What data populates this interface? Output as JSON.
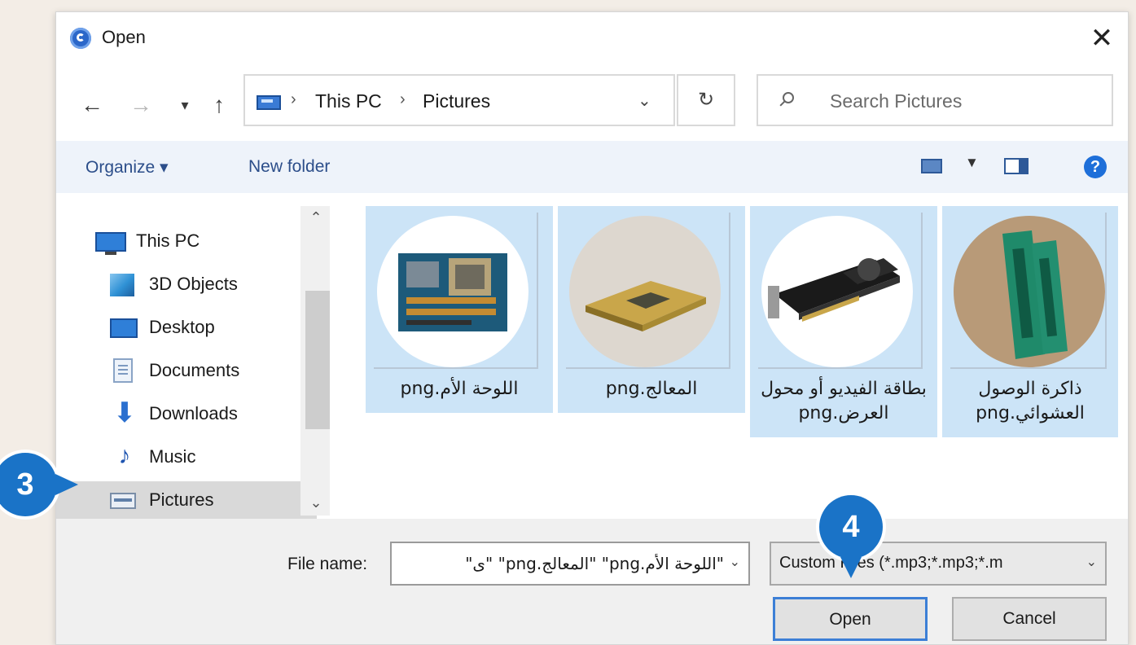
{
  "window": {
    "title": "Open",
    "close_glyph": "✕"
  },
  "nav": {
    "back_glyph": "←",
    "forward_glyph": "→",
    "recent_glyph": "▾",
    "up_glyph": "↑",
    "breadcrumb": [
      "This PC",
      "Pictures"
    ],
    "breadcrumb_sep": "›",
    "dropdown_glyph": "⌄",
    "refresh_glyph": "↻",
    "search_placeholder": "Search Pictures"
  },
  "commandbar": {
    "organize": "Organize ▾",
    "new_folder": "New folder",
    "help": "?"
  },
  "sidebar": {
    "items": [
      {
        "label": "This PC",
        "icon": "computer-icon"
      },
      {
        "label": "3D Objects",
        "icon": "3d-objects-icon"
      },
      {
        "label": "Desktop",
        "icon": "desktop-icon"
      },
      {
        "label": "Documents",
        "icon": "documents-icon"
      },
      {
        "label": "Downloads",
        "icon": "downloads-icon"
      },
      {
        "label": "Music",
        "icon": "music-icon"
      },
      {
        "label": "Pictures",
        "icon": "pictures-icon",
        "selected": true
      }
    ],
    "up_glyph": "⌃",
    "down_glyph": "⌄"
  },
  "files": [
    {
      "name": "اللوحة الأم.png",
      "thumb": "motherboard",
      "selected": true
    },
    {
      "name": "المعالج.png",
      "thumb": "processor",
      "selected": true
    },
    {
      "name": "بطاقة الفيديو أو محول العرض.png",
      "thumb": "video-card",
      "selected": true
    },
    {
      "name": "ذاكرة الوصول العشوائي.png",
      "thumb": "ram",
      "selected": true
    }
  ],
  "footer": {
    "file_name_label": "File name:",
    "file_name_value": "\"اللوحة الأم.png\" \"المعالج.png\" \"ى\"",
    "filter_value": "Custom Files (*.mp3;*.mp3;*.m",
    "open_label": "Open",
    "cancel_label": "Cancel"
  },
  "annotations": {
    "step3": "3",
    "step4": "4"
  },
  "colors": {
    "selection": "#cce4f7",
    "badge": "#1a73c7",
    "accent": "#3c7fd6"
  }
}
